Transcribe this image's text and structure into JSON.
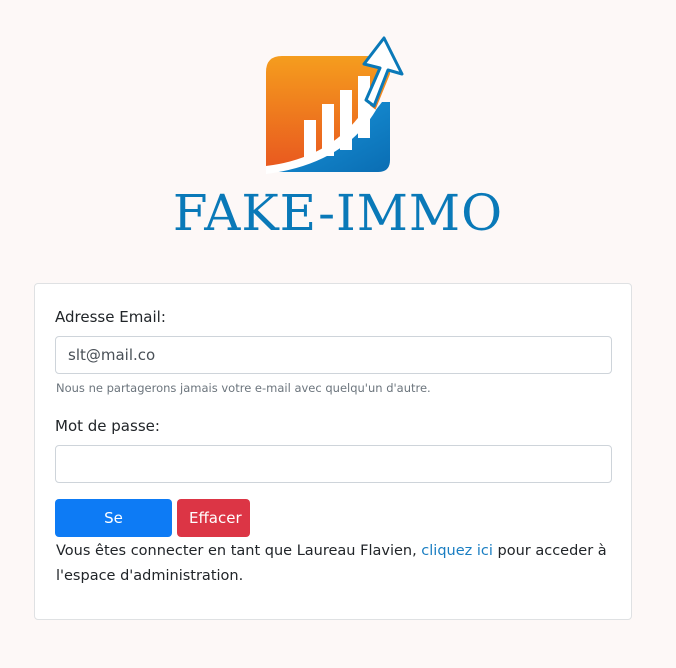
{
  "brand": {
    "name": "FAKE-IMMO",
    "colors": {
      "orange": "#f08a1c",
      "blue": "#0a79b8"
    }
  },
  "form": {
    "email_label": "Adresse Email:",
    "email_value": "slt@mail.co",
    "email_help": "Nous ne partagerons jamais votre e-mail avec quelqu'un d'autre.",
    "password_label": "Mot de passe:",
    "password_value": "",
    "submit_label": "Se connecter",
    "reset_label": "Effacer"
  },
  "status": {
    "text_before": "Vous êtes connecter en tant que Laureau Flavien, ",
    "link_text": "cliquez ici",
    "text_after": " pour acceder à l'espace d'administration."
  }
}
